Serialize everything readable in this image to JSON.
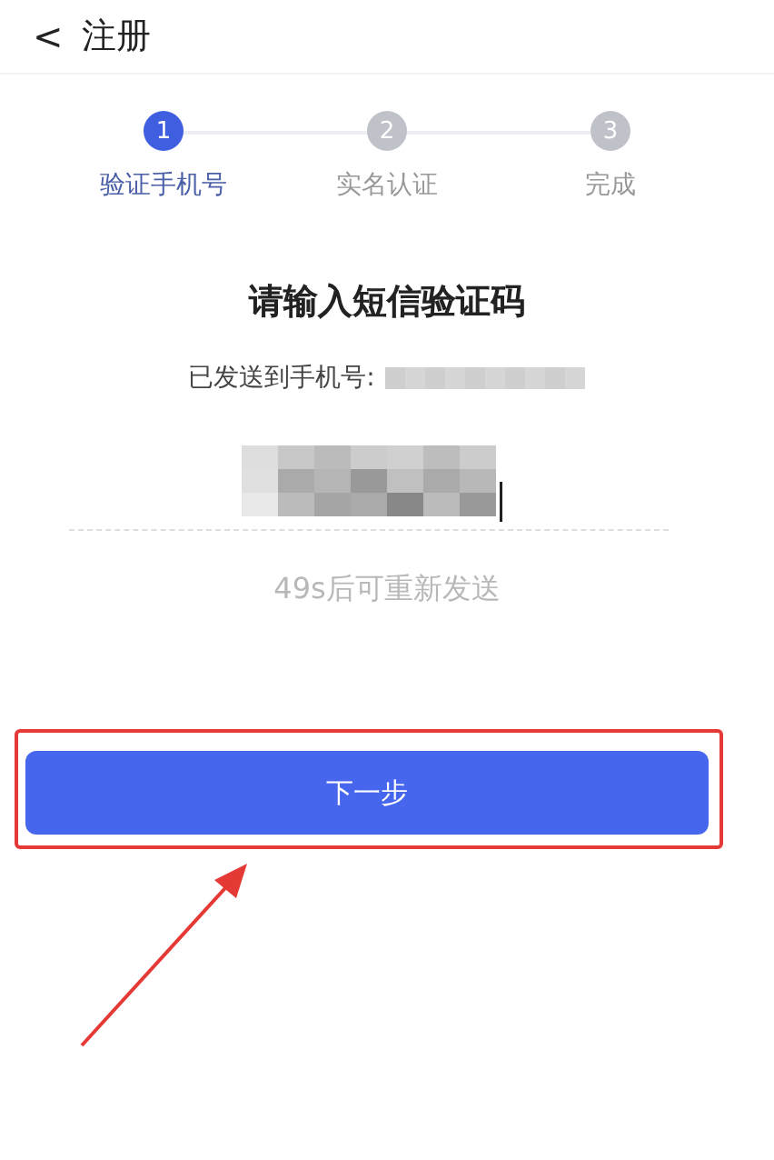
{
  "header": {
    "back": "<",
    "title": "注册"
  },
  "steps": [
    {
      "number": "1",
      "label": "验证手机号",
      "selected": true
    },
    {
      "number": "2",
      "label": "实名认证",
      "selected": false
    },
    {
      "number": "3",
      "label": "完成",
      "selected": false
    }
  ],
  "heading": "请输入短信验证码",
  "sent_to": "已发送到手机号:",
  "resend": "49s后可重新发送",
  "next_button": "下一步"
}
